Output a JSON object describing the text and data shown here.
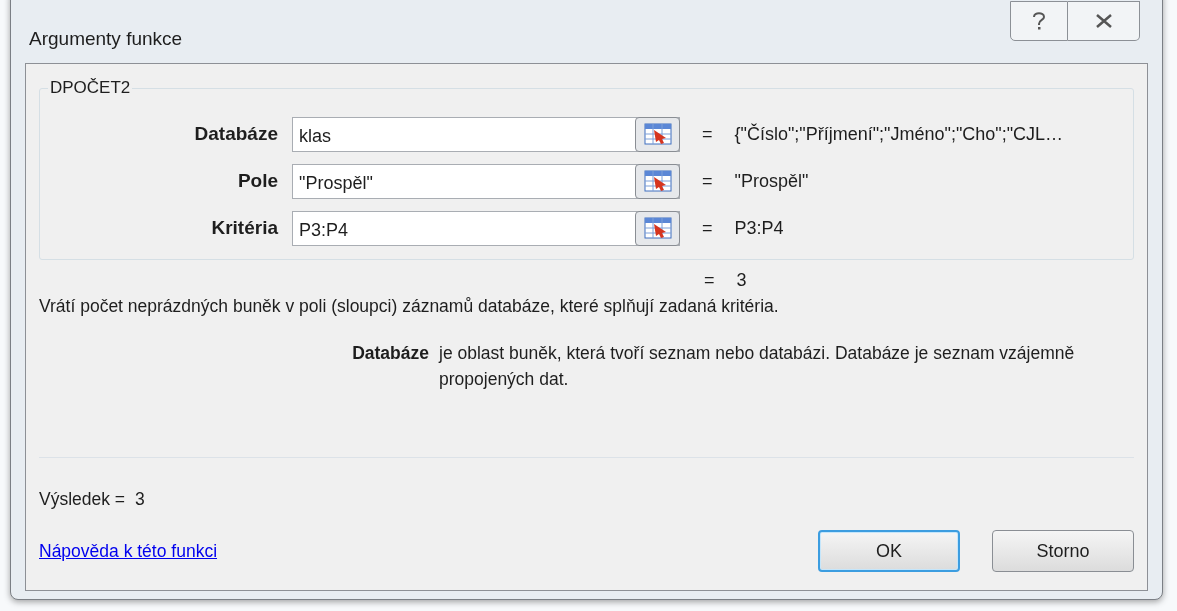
{
  "window": {
    "title": "Argumenty funkce"
  },
  "function": {
    "name": "DPOČET2",
    "arguments": [
      {
        "label": "Databáze",
        "value": "klas",
        "equals": "=",
        "result": "{\"Číslo\";\"Příjmení\";\"Jméno\";\"Cho\";\"CJL…"
      },
      {
        "label": "Pole",
        "value": "\"Prospěl\"",
        "equals": "=",
        "result": "\"Prospěl\""
      },
      {
        "label": "Kritéria",
        "value": "P3:P4",
        "equals": "=",
        "result": "P3:P4"
      }
    ],
    "formula_equals": "=",
    "formula_result": "3"
  },
  "description": "Vrátí počet neprázdných buněk v poli (sloupci) záznamů databáze, které splňují zadaná kritéria.",
  "argument_help": {
    "name": "Databáze",
    "text": "je oblast buněk, která tvoří seznam nebo databázi. Databáze je seznam vzájemně propojených dat."
  },
  "result": {
    "label": "Výsledek =",
    "value": "3"
  },
  "help_link": "Nápověda k této funkci",
  "buttons": [
    {
      "label": "OK",
      "default": true
    },
    {
      "label": "Storno",
      "default": false
    }
  ]
}
